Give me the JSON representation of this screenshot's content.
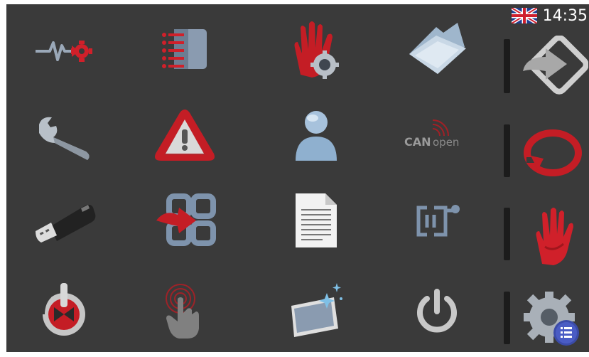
{
  "status_bar": {
    "language_flag": "uk-flag-icon",
    "time": "14:35"
  },
  "grid": [
    {
      "icon": "monitor-signal-gear-icon"
    },
    {
      "icon": "list-notebook-icon"
    },
    {
      "icon": "hand-gear-icon"
    },
    {
      "icon": "open-folder-icon"
    },
    {
      "icon": "wrench-icon"
    },
    {
      "icon": "warning-triangle-icon"
    },
    {
      "icon": "user-icon"
    },
    {
      "icon": "canopen-icon",
      "text_bold": "CAN",
      "text_light": "open"
    },
    {
      "icon": "usb-drive-icon"
    },
    {
      "icon": "grid-import-icon"
    },
    {
      "icon": "document-icon"
    },
    {
      "icon": "io-connector-icon"
    },
    {
      "icon": "power-stop-icon"
    },
    {
      "icon": "touch-calibration-icon"
    },
    {
      "icon": "screen-clean-icon"
    },
    {
      "icon": "power-icon"
    }
  ],
  "side": [
    {
      "icon": "login-arrow-icon"
    },
    {
      "icon": "refresh-icon"
    },
    {
      "icon": "red-hand-stop-icon"
    },
    {
      "icon": "settings-menu-icon"
    }
  ],
  "colors": {
    "background": "#3a3a3a",
    "accent_red": "#d0202a",
    "steel_blue": "#7e93ac"
  }
}
